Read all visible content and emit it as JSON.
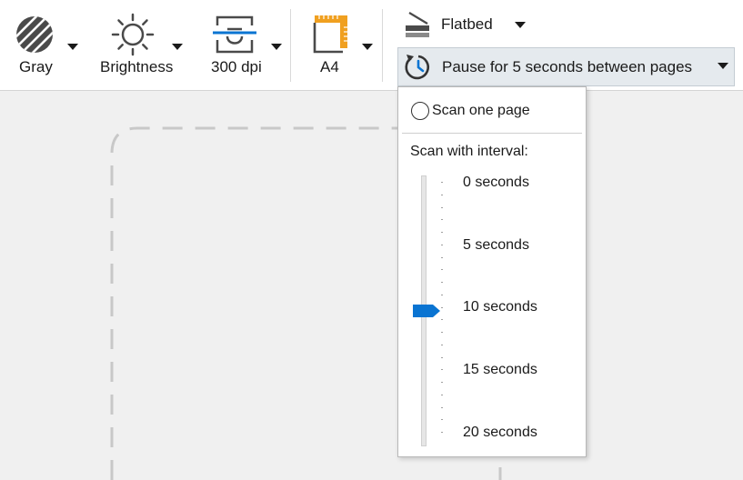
{
  "toolbar": {
    "color_mode": {
      "label": "Gray",
      "icon": "gray-mode-icon"
    },
    "brightness": {
      "label": "Brightness",
      "icon": "sun-icon"
    },
    "resolution": {
      "label": "300 dpi",
      "icon": "resolution-icon"
    },
    "page_size": {
      "label": "A4",
      "icon": "page-size-icon"
    },
    "source": {
      "label": "Flatbed",
      "icon": "flatbed-scanner-icon"
    },
    "pause": {
      "label": "Pause for 5 seconds between pages",
      "icon": "timer-icon"
    }
  },
  "popup": {
    "scan_one_page": "Scan one page",
    "interval_title": "Scan with interval:",
    "options": [
      "0 seconds",
      "5 seconds",
      "10 seconds",
      "15 seconds",
      "20 seconds"
    ],
    "selected_index": 2
  },
  "colors": {
    "accent": "#0a74d2",
    "page_size_accent": "#f0a020",
    "icon_dark": "#444444",
    "canvas_bg": "#f0f0f0"
  }
}
